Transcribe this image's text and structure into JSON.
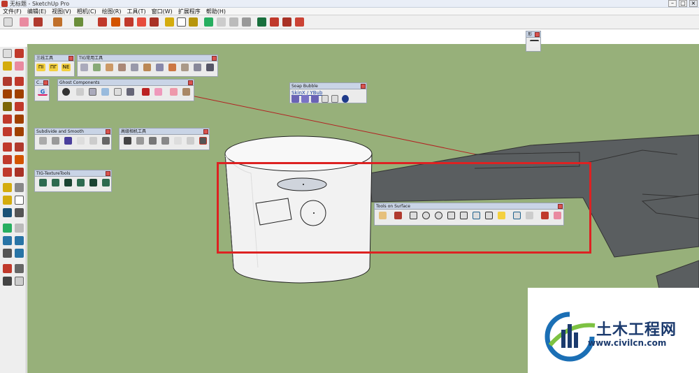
{
  "window": {
    "title": "无标题 - SketchUp Pro"
  },
  "menu": [
    "文件(F)",
    "编辑(E)",
    "视图(V)",
    "相机(C)",
    "绘图(R)",
    "工具(T)",
    "窗口(W)",
    "扩展程序",
    "帮助(H)"
  ],
  "palettes": {
    "sanxian": {
      "title": "三线工具",
      "texts": [
        "ΠI",
        "ΠΓ",
        "NE"
      ]
    },
    "tig": {
      "title": "TIG常用工具"
    },
    "c": {
      "title": "C...",
      "icon_text": "G"
    },
    "ghost": {
      "title": "Ghost Components"
    },
    "soap": {
      "title": "Soap Bubble",
      "label": "SkinX / YBub"
    },
    "subdivide": {
      "title": "Subdivide and Smooth"
    },
    "camera": {
      "title": "高级相机工具"
    },
    "texture": {
      "title": "TIG-TextureTools"
    },
    "surface": {
      "title": "Tools on Surface"
    },
    "small": {
      "title": "形"
    }
  },
  "watermark": {
    "name": "土木工程网",
    "url": "www.civilcn.com"
  },
  "colors": {
    "ground": "#97b07a",
    "highlight": "#dd2222",
    "brand": "#1b3a6d"
  }
}
